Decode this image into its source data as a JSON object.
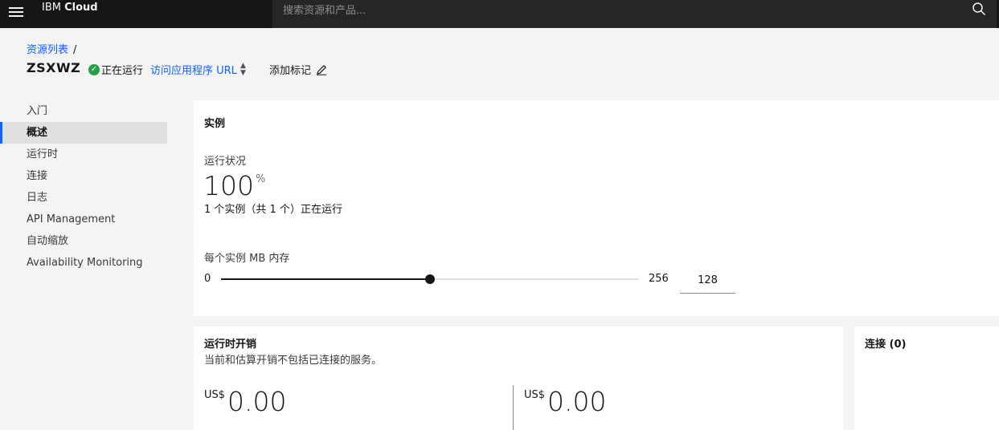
{
  "header": {
    "brand_prefix": "IBM",
    "brand_name": "Cloud",
    "search_placeholder": "搜索资源和产品..."
  },
  "breadcrumb": {
    "link": "资源列表",
    "separator": "/"
  },
  "app": {
    "name": "ZSXWZ",
    "status": "正在运行",
    "visit_url": "访问应用程序 URL",
    "add_tag": "添加标记"
  },
  "sidenav": {
    "items": [
      {
        "label": "入门"
      },
      {
        "label": "概述"
      },
      {
        "label": "运行时"
      },
      {
        "label": "连接"
      },
      {
        "label": "日志"
      },
      {
        "label": "API Management"
      },
      {
        "label": "自动缩放"
      },
      {
        "label": "Availability Monitoring"
      }
    ]
  },
  "instances": {
    "title": "实例",
    "health_label": "运行状况",
    "health_value": "100",
    "health_unit": "%",
    "running_text": "1 个实例（共 1 个）正在运行",
    "memory_label": "每个实例 MB 内存",
    "slider": {
      "min": "0",
      "max": "256",
      "value": "128",
      "fill_fraction": 0.5
    }
  },
  "costs": {
    "title": "运行时开销",
    "subtitle": "当前和估算开销不包括已连接的服务。",
    "current": {
      "currency": "US$",
      "amount": "0.00"
    },
    "estimated": {
      "currency": "US$",
      "amount": "0.00"
    }
  },
  "connections": {
    "title": "连接 (0)"
  },
  "colors": {
    "accent": "#0f62fe",
    "status_green": "#24a148",
    "topbar": "#161616"
  }
}
